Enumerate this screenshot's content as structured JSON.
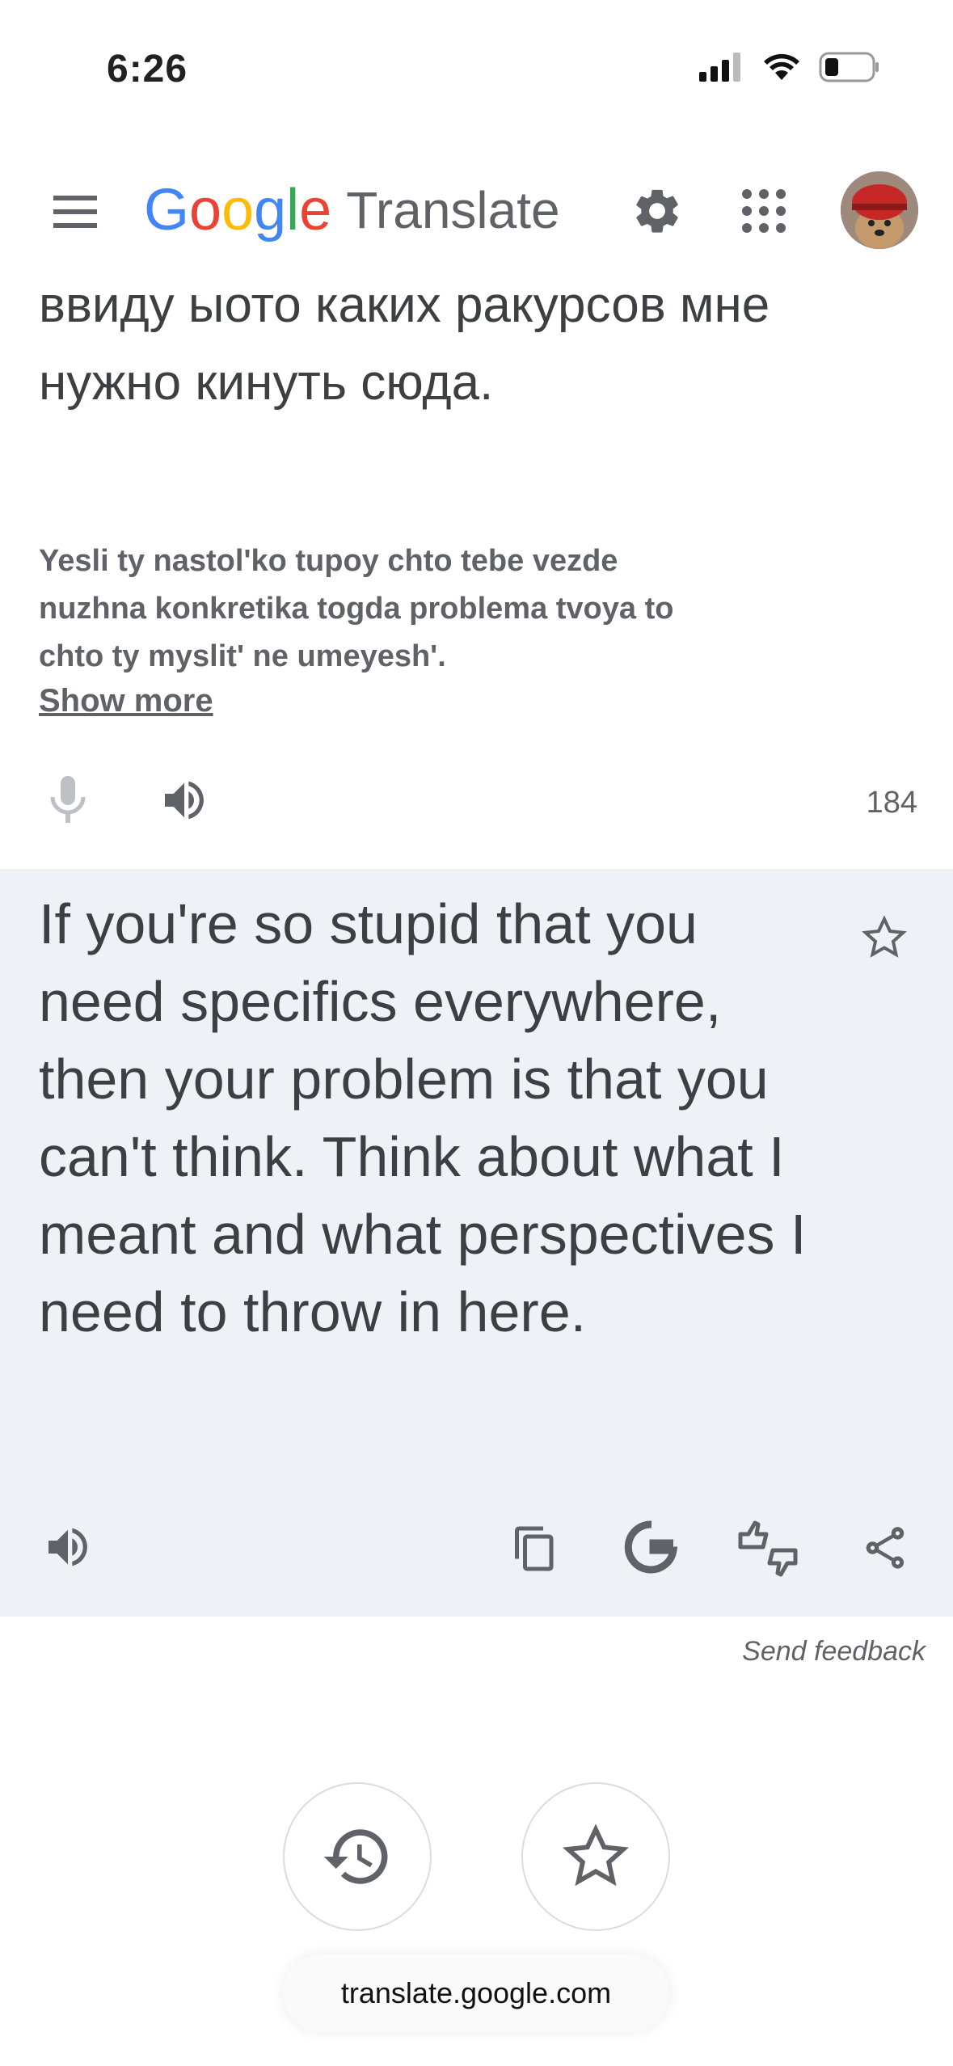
{
  "status_bar": {
    "time": "6:26"
  },
  "header": {
    "logo_letters": [
      "G",
      "o",
      "o",
      "g",
      "l",
      "e"
    ],
    "logo_colors": [
      "#4285F4",
      "#EA4335",
      "#FBBC05",
      "#4285F4",
      "#34A853",
      "#EA4335"
    ],
    "logo_word": "Translate"
  },
  "source": {
    "text": "ввиду ыото каких ракурсов мне нужно кинуть сюда.",
    "transliteration": "Yesli ty nastol'ko tupoy chto tebe vezde nuzhna konkretika togda problema tvoya to chto ty myslit' ne umeyesh'.",
    "show_more_label": "Show more",
    "char_count": "184"
  },
  "result": {
    "text": "If you're so stupid that you need specifics everywhere, then your problem is that you can't think. Think about what I meant and what perspectives I need to throw in here.",
    "background": "#eef1f6"
  },
  "footer": {
    "send_feedback_label": "Send feedback",
    "url": "translate.google.com"
  },
  "icons": [
    "menu-icon",
    "gear-icon",
    "apps-grid-icon",
    "avatar",
    "microphone-icon",
    "speaker-icon",
    "star-icon",
    "copy-icon",
    "google-g-icon",
    "feedback-icon",
    "share-icon",
    "history-icon"
  ]
}
